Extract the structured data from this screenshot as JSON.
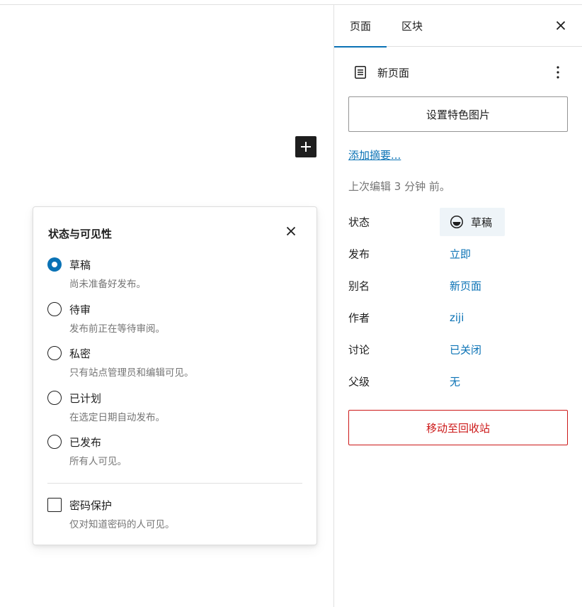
{
  "canvas": {
    "inserter_icon": "plus-icon"
  },
  "status_popover": {
    "title": "状态与可见性",
    "close_icon": "close-icon",
    "options": [
      {
        "label": "草稿",
        "help": "尚未准备好发布。",
        "checked": true
      },
      {
        "label": "待审",
        "help": "发布前正在等待审阅。",
        "checked": false
      },
      {
        "label": "私密",
        "help": "只有站点管理员和编辑可见。",
        "checked": false
      },
      {
        "label": "已计划",
        "help": "在选定日期自动发布。",
        "checked": false
      },
      {
        "label": "已发布",
        "help": "所有人可见。",
        "checked": false
      }
    ],
    "password": {
      "label": "密码保护",
      "help": "仅对知道密码的人可见。",
      "checked": false
    }
  },
  "sidebar": {
    "tabs": [
      {
        "label": "页面",
        "active": true
      },
      {
        "label": "区块",
        "active": false
      }
    ],
    "document": {
      "icon": "page-icon",
      "title": "新页面"
    },
    "featured_image_label": "设置特色图片",
    "excerpt_link": "添加摘要...",
    "last_edited": "上次编辑 3 分钟 前。",
    "meta": {
      "status": {
        "label": "状态",
        "value": "草稿",
        "icon": "draft-icon"
      },
      "publish": {
        "label": "发布",
        "value": "立即"
      },
      "slug": {
        "label": "别名",
        "value": "新页面"
      },
      "author": {
        "label": "作者",
        "value": "ziji"
      },
      "discussion": {
        "label": "讨论",
        "value": "已关闭"
      },
      "parent": {
        "label": "父级",
        "value": "无"
      }
    },
    "trash_label": "移动至回收站"
  },
  "colors": {
    "accent": "#0a72b5",
    "danger": "#cc1818",
    "muted": "#757575",
    "text": "#1e1e1e"
  }
}
